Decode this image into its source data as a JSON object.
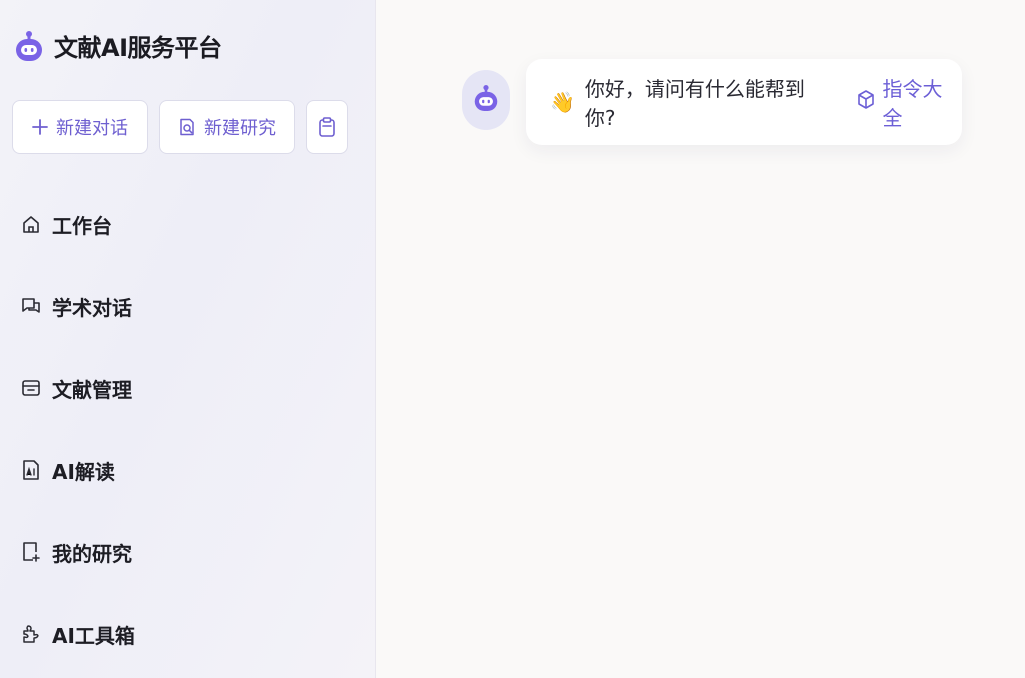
{
  "brand": {
    "title": "文献AI服务平台",
    "logo_icon": "robot-icon",
    "accent": "#6e5fd0"
  },
  "actions": {
    "new_chat": {
      "label": "新建对话",
      "icon": "plus-icon"
    },
    "new_research": {
      "label": "新建研究",
      "icon": "search-doc-icon"
    },
    "clipboard": {
      "icon": "clipboard-icon"
    }
  },
  "sidebar": {
    "items": [
      {
        "label": "工作台",
        "icon": "home-icon"
      },
      {
        "label": "学术对话",
        "icon": "chat-bubbles-icon"
      },
      {
        "label": "文献管理",
        "icon": "archive-icon"
      },
      {
        "label": "AI解读",
        "icon": "ai-document-icon"
      },
      {
        "label": "我的研究",
        "icon": "research-doc-icon"
      },
      {
        "label": "AI工具箱",
        "icon": "puzzle-icon"
      }
    ]
  },
  "chat": {
    "wave": "👋",
    "greeting": "你好，请问有什么能帮到你?",
    "command_link": "指令大全",
    "command_icon": "cube-icon"
  }
}
